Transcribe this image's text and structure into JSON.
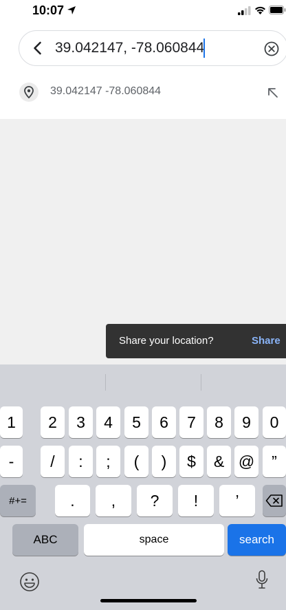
{
  "status_bar": {
    "time": "10:07"
  },
  "search": {
    "value": "39.042147, -78.060844"
  },
  "suggestion": {
    "text": "39.042147 -78.060844"
  },
  "snackbar": {
    "message": "Share your location?",
    "action": "Share"
  },
  "keyboard": {
    "row1": [
      "1",
      "2",
      "3",
      "4",
      "5",
      "6",
      "7",
      "8",
      "9",
      "0"
    ],
    "row2": [
      "-",
      "/",
      ":",
      ";",
      "(",
      ")",
      "$",
      "&",
      "@",
      "”"
    ],
    "row3": [
      ".",
      ",",
      "?",
      "!",
      "’"
    ],
    "shift_label": "#+=",
    "abc_label": "ABC",
    "space_label": "space",
    "search_label": "search"
  },
  "colors": {
    "accent": "#1a73e8",
    "snackbar_bg": "#323232",
    "snackbar_action": "#8ab4f8",
    "keyboard_bg": "#d1d3d9"
  }
}
